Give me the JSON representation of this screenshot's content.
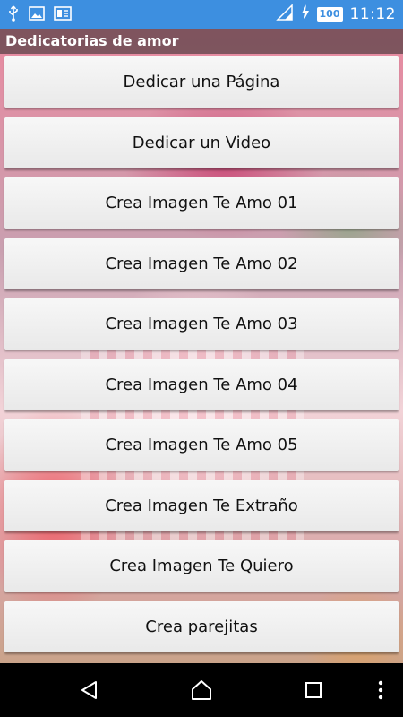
{
  "status_bar": {
    "time": "11:12",
    "battery": "100",
    "icons": [
      "usb-icon",
      "image-icon",
      "notification-icon",
      "signal-icon",
      "charging-icon",
      "battery-icon"
    ]
  },
  "app_bar": {
    "title": "Dedicatorias de amor"
  },
  "buttons": [
    "Dedicar una Página",
    "Dedicar un Video",
    "Crea Imagen Te Amo 01",
    "Crea Imagen Te Amo 02",
    "Crea Imagen Te Amo 03",
    "Crea Imagen Te Amo 04",
    "Crea Imagen Te Amo 05",
    "Crea Imagen Te Extraño",
    "Crea Imagen Te Quiero",
    "Crea parejitas"
  ],
  "nav_bar": {
    "icons": [
      "back-icon",
      "home-icon",
      "recents-icon",
      "more-icon"
    ]
  },
  "colors": {
    "status_bar": "#3d8fe0",
    "button_bg": "#efefef",
    "nav_bar": "#000000"
  }
}
